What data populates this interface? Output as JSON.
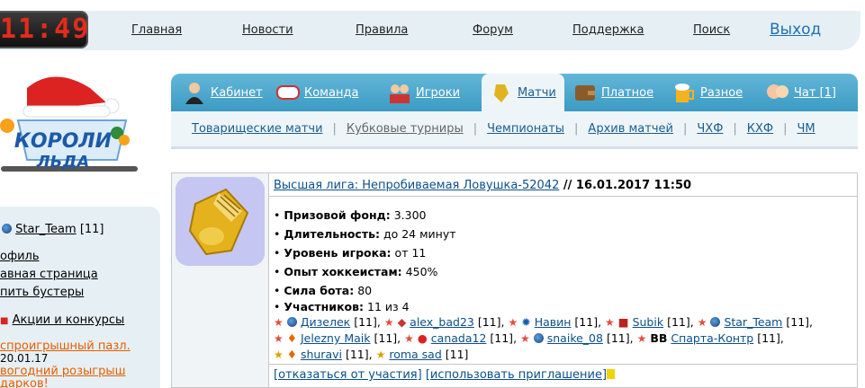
{
  "clock": "11:49",
  "top_nav": [
    "Главная",
    "Новости",
    "Правила",
    "Форум",
    "Поддержка",
    "Поиск"
  ],
  "logout": "Выход",
  "logo": {
    "line1": "КОРОЛИ",
    "line2": "ЛЬДА"
  },
  "tabs": [
    "Кабинет",
    "Команда",
    "Игроки",
    "Матчи",
    "Платное",
    "Разное",
    "Чат [1]"
  ],
  "subnav": [
    "Товарищеские матчи",
    "Кубковые турниры",
    "Чемпионаты",
    "Архив матчей",
    "ЧХФ",
    "КХФ",
    "ЧМ"
  ],
  "sidebar": {
    "team": "Star_Team",
    "team_level": "[11]",
    "links": [
      "офиль",
      "авная страница",
      "пить бустеры"
    ],
    "promo": "Акции и конкурсы",
    "orange1": "спроигрышный пазл.",
    "date": "20.01.17",
    "orange2": "вогодний розыгрыш",
    "orange3": "дарков!"
  },
  "match": {
    "title_link": "Высшая лига: Непробиваемая Ловушка-52042",
    "title_rest": " // 16.01.2017 11:50",
    "details": [
      {
        "label": "Призовой фонд:",
        "value": "3.300"
      },
      {
        "label": "Длительность:",
        "value": "до 24 минут"
      },
      {
        "label": "Уровень игрока:",
        "value": "от 11"
      },
      {
        "label": "Опыт хоккеистам:",
        "value": "450%"
      },
      {
        "label": "Сила бота:",
        "value": "80"
      },
      {
        "label": "Участников:",
        "value": "11 из 4"
      }
    ],
    "players": [
      {
        "name": "Дизелек",
        "lvl": "[11]"
      },
      {
        "name": "alex_bad23",
        "lvl": "[11]"
      },
      {
        "name": "Навин",
        "lvl": "[11]"
      },
      {
        "name": "Subik",
        "lvl": "[11]"
      },
      {
        "name": "Star_Team",
        "lvl": "[11]"
      },
      {
        "name": "Jelezny Maik",
        "lvl": "[11]"
      },
      {
        "name": "canada12",
        "lvl": "[11]"
      },
      {
        "name": "snaike_08",
        "lvl": "[11]"
      },
      {
        "name": "Спарта-Контр",
        "lvl": "[11]",
        "tag": "BB"
      },
      {
        "name": "shuravi",
        "lvl": "[11]"
      },
      {
        "name": "roma sad",
        "lvl": "[11]"
      }
    ],
    "action_decline": "[отказаться от участия]",
    "action_invite": "[использовать приглашение]"
  }
}
